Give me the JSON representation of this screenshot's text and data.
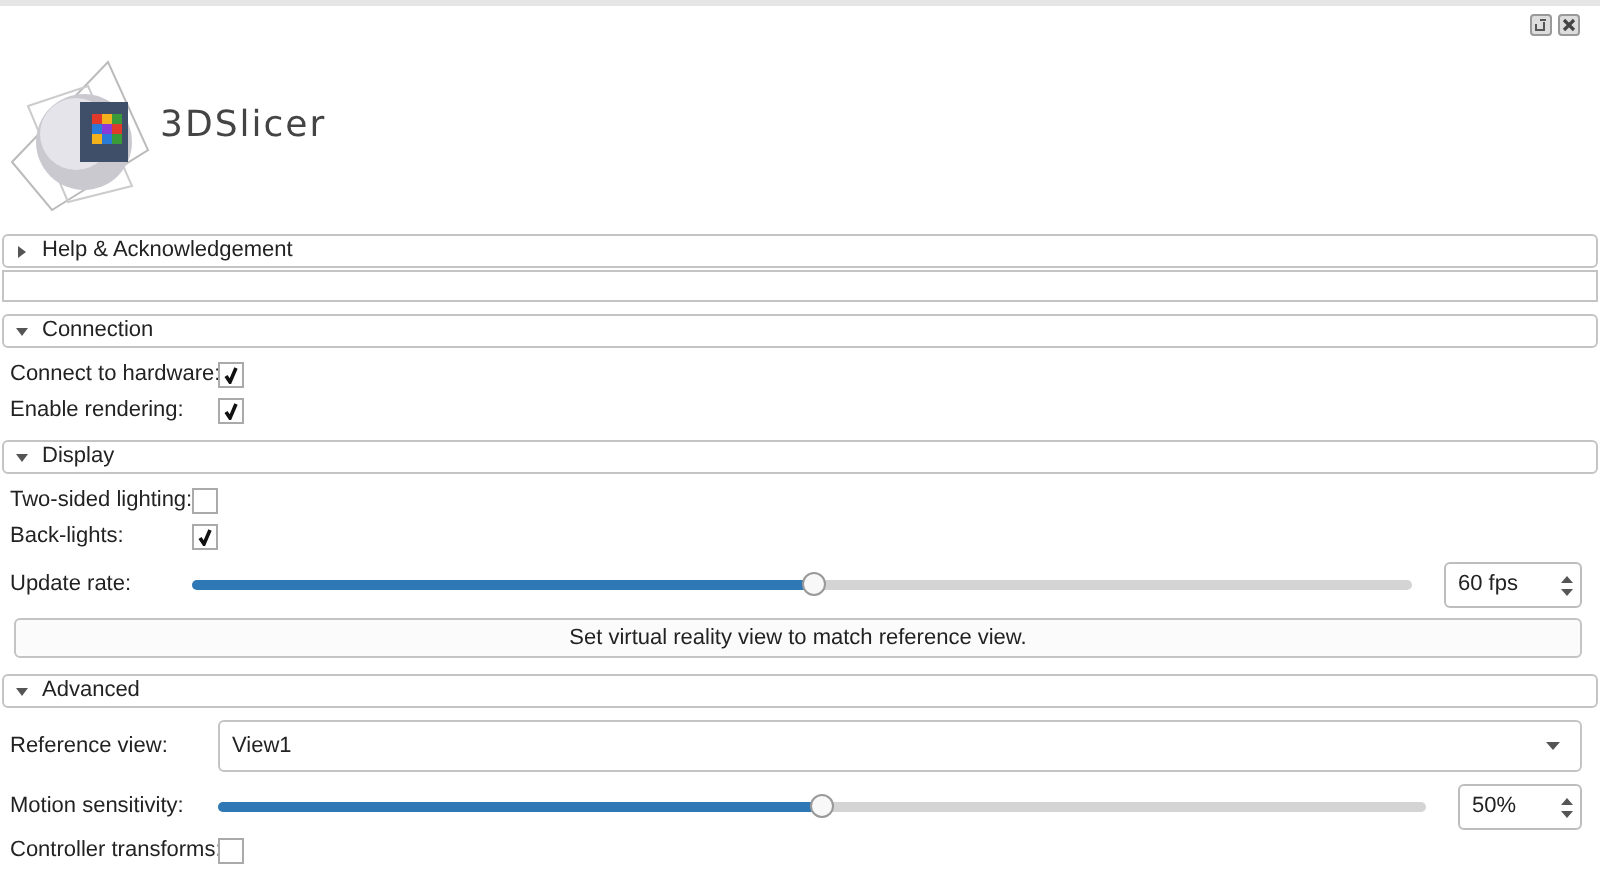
{
  "logo": {
    "text": "3DSlicer"
  },
  "sections": [
    {
      "title": "Help & Acknowledgement",
      "expanded": false
    },
    {
      "title": "Connection",
      "expanded": true,
      "rows": [
        {
          "kind": "checkbox",
          "label": "Connect to hardware:",
          "checked": true
        },
        {
          "kind": "checkbox",
          "label": "Enable rendering:",
          "checked": true
        }
      ]
    },
    {
      "title": "Display",
      "expanded": true,
      "rows": [
        {
          "kind": "checkbox",
          "label": "Two-sided lighting:",
          "checked": false
        },
        {
          "kind": "checkbox",
          "label": "Back-lights:",
          "checked": true
        },
        {
          "kind": "slider",
          "label": "Update rate:",
          "level": 0.51,
          "value": "60 fps"
        },
        {
          "kind": "button",
          "label": "Set virtual reality view to match reference view."
        }
      ]
    },
    {
      "title": "Advanced",
      "expanded": true,
      "rows": [
        {
          "kind": "combo",
          "label": "Reference view:",
          "value": "View1"
        },
        {
          "kind": "slider",
          "label": "Motion sensitivity:",
          "level": 0.5,
          "value": "50%"
        },
        {
          "kind": "checkbox",
          "label": "Controller transforms:",
          "checked": false
        }
      ]
    }
  ]
}
